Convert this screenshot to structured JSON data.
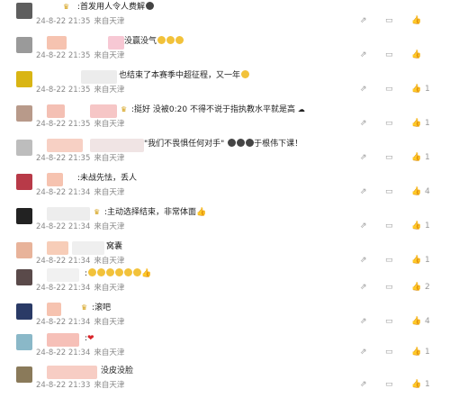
{
  "comments": [
    {
      "prefix": "",
      "text": ":首发用人令人费解",
      "time": "24-8-22 21:35",
      "source": "来自天津",
      "likes": "",
      "avatar": "#5e5e5e"
    },
    {
      "prefix": "",
      "text": "没赢没气",
      "time": "24-8-22 21:35",
      "source": "来自天津",
      "likes": "",
      "avatar": "#9a9a9a"
    },
    {
      "prefix": "",
      "text": "也结束了本赛季中超征程，又一年",
      "time": "24-8-22 21:35",
      "source": "来自天津",
      "likes": "1",
      "avatar": "#d9b514"
    },
    {
      "prefix": "",
      "text": ":挺好 没被0:20 不得不说于指执教水平就是高",
      "time": "24-8-22 21:35",
      "source": "来自天津",
      "likes": "1",
      "avatar": "#b89a8a"
    },
    {
      "prefix": "",
      "text": "\"我们不畏惧任何对手\"",
      "text2": "于根伟下课！",
      "time": "24-8-22 21:35",
      "source": "来自天津",
      "likes": "1",
      "avatar": "#bdbdbd"
    },
    {
      "prefix": "",
      "text": ":未战先怯，丢人",
      "time": "24-8-22 21:34",
      "source": "来自天津",
      "likes": "4",
      "avatar": "#b83a48"
    },
    {
      "prefix": "",
      "text": ":主动选择结束，非常体面",
      "time": "24-8-22 21:34",
      "source": "来自天津",
      "likes": "1",
      "avatar": "#222222"
    },
    {
      "prefix": "",
      "text": "窝囊",
      "time": "24-8-22 21:34",
      "source": "来自天津",
      "likes": "1",
      "avatar": "#e8b39a"
    },
    {
      "prefix": "",
      "text": ":",
      "time": "24-8-22 21:34",
      "source": "来自天津",
      "likes": "2",
      "avatar": "#5a4a4a"
    },
    {
      "prefix": "",
      "text": ":滚吧",
      "time": "24-8-22 21:34",
      "source": "来自天津",
      "likes": "4",
      "avatar": "#2a3a66"
    },
    {
      "prefix": "",
      "text": ":",
      "time": "24-8-22 21:34",
      "source": "来自天津",
      "likes": "1",
      "avatar": "#8ab8c8"
    },
    {
      "prefix": "",
      "text": "没皮没脸",
      "time": "24-8-22 21:33",
      "source": "来自天津",
      "likes": "1",
      "avatar": "#8a7a5a"
    }
  ],
  "icons": {
    "share": "share-icon",
    "comment": "comment-icon",
    "like": "like-icon"
  }
}
